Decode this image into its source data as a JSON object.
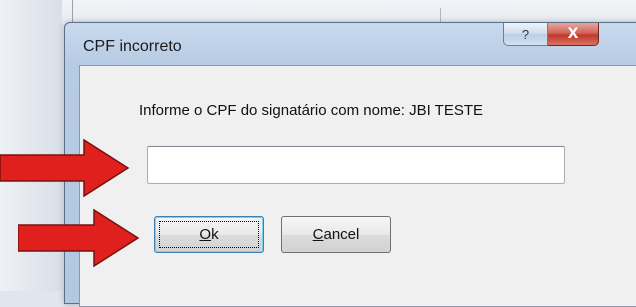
{
  "dialog": {
    "title": "CPF incorreto",
    "help_glyph": "?",
    "close_glyph": "X",
    "prompt": "Informe o CPF do signatário com nome: JBI TESTE",
    "cpf_input": {
      "value": "",
      "placeholder": ""
    },
    "ok_label_mnemonic": "O",
    "ok_label_rest": "k",
    "cancel_label_mnemonic": "C",
    "cancel_label_rest": "ancel"
  },
  "annotations": {
    "arrow_color": "#e0201c",
    "arrow_count": 2
  }
}
